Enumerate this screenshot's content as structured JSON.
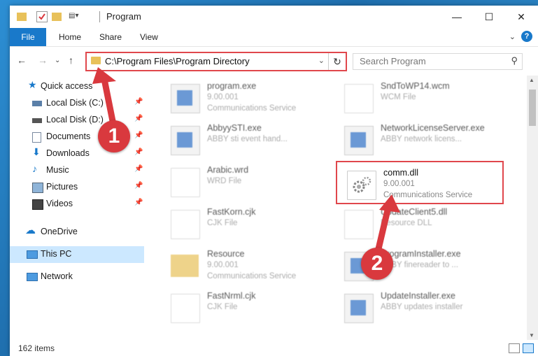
{
  "window": {
    "title": "Program"
  },
  "ribbon": {
    "tabs": [
      {
        "label": "File"
      },
      {
        "label": "Home"
      },
      {
        "label": "Share"
      },
      {
        "label": "View"
      }
    ]
  },
  "address": {
    "path": "C:\\Program Files\\Program Directory"
  },
  "search": {
    "placeholder": "Search Program"
  },
  "sidebar": {
    "items": [
      {
        "label": "Quick access"
      },
      {
        "label": "Local Disk (C:)"
      },
      {
        "label": "Local Disk (D:)"
      },
      {
        "label": "Documents"
      },
      {
        "label": "Downloads"
      },
      {
        "label": "Music"
      },
      {
        "label": "Pictures"
      },
      {
        "label": "Videos"
      },
      {
        "label": "OneDrive"
      },
      {
        "label": "This PC"
      },
      {
        "label": "Network"
      }
    ]
  },
  "files": [
    {
      "name": "program.exe",
      "type": "9.00.001",
      "sub": "Communications Service"
    },
    {
      "name": "SndToWP14.wcm",
      "type": "WCM File",
      "sub": ""
    },
    {
      "name": "AbbyySTI.exe",
      "type": "ABBY sti event hand...",
      "sub": ""
    },
    {
      "name": "NetworkLicenseServer.exe",
      "type": "ABBY network licens...",
      "sub": ""
    },
    {
      "name": "Arabic.wrd",
      "type": "WRD File",
      "sub": ""
    },
    {
      "name": "comm.dll",
      "type": "9.00.001",
      "sub": "Communications Service"
    },
    {
      "name": "FastKorn.cjk",
      "type": "CJK File",
      "sub": ""
    },
    {
      "name": "UpdateClient5.dll",
      "type": "Resource DLL",
      "sub": ""
    },
    {
      "name": "Resource",
      "type": "9.00.001",
      "sub": "Communications Service"
    },
    {
      "name": "ProgramInstaller.exe",
      "type": "ABBY finereader to ...",
      "sub": ""
    },
    {
      "name": "FastNrml.cjk",
      "type": "CJK File",
      "sub": ""
    },
    {
      "name": "UpdateInstaller.exe",
      "type": "ABBY updates installer",
      "sub": ""
    }
  ],
  "status": {
    "count": "162 items"
  },
  "callouts": {
    "one": "1",
    "two": "2"
  },
  "colors": {
    "accent": "#1979ca",
    "highlight": "#e0474c",
    "selection": "#cce8ff"
  }
}
